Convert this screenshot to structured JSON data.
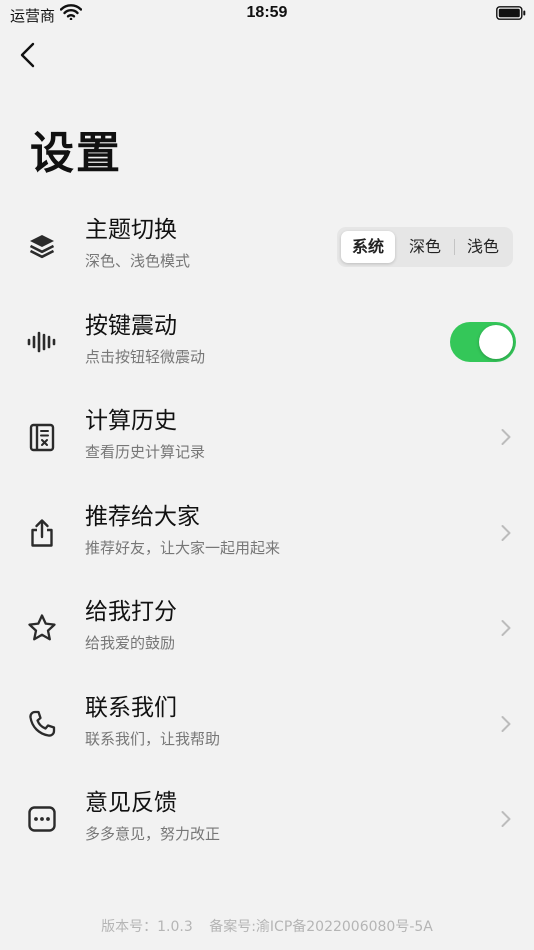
{
  "status_bar": {
    "carrier": "运营商",
    "time": "18:59"
  },
  "page": {
    "title": "设置"
  },
  "settings": {
    "items": [
      {
        "title": "主题切换",
        "subtitle": "深色、浅色模式",
        "icon": "layers-icon"
      },
      {
        "title": "按键震动",
        "subtitle": "点击按钮轻微震动",
        "icon": "vibration-waveform-icon"
      },
      {
        "title": "计算历史",
        "subtitle": "查看历史计算记录",
        "icon": "history-ledger-icon"
      },
      {
        "title": "推荐给大家",
        "subtitle": "推荐好友，让大家一起用起来",
        "icon": "share-icon"
      },
      {
        "title": "给我打分",
        "subtitle": "给我爱的鼓励",
        "icon": "star-icon"
      },
      {
        "title": "联系我们",
        "subtitle": "联系我们，让我帮助",
        "icon": "phone-icon"
      },
      {
        "title": "意见反馈",
        "subtitle": "多多意见，努力改正",
        "icon": "chat-bubble-icon"
      }
    ]
  },
  "theme_selector": {
    "options": [
      "系统",
      "深色",
      "浅色"
    ],
    "selected": "系统"
  },
  "vibration_toggle": {
    "on": true
  },
  "footer": {
    "version": "版本号：1.0.3",
    "icp": "备案号:渝ICP备2022006080号-5A"
  },
  "colors": {
    "background": "#f2f2f2",
    "toggle_on": "#34c759",
    "subtitle": "#777777",
    "footer_text": "#b5b5b5"
  }
}
